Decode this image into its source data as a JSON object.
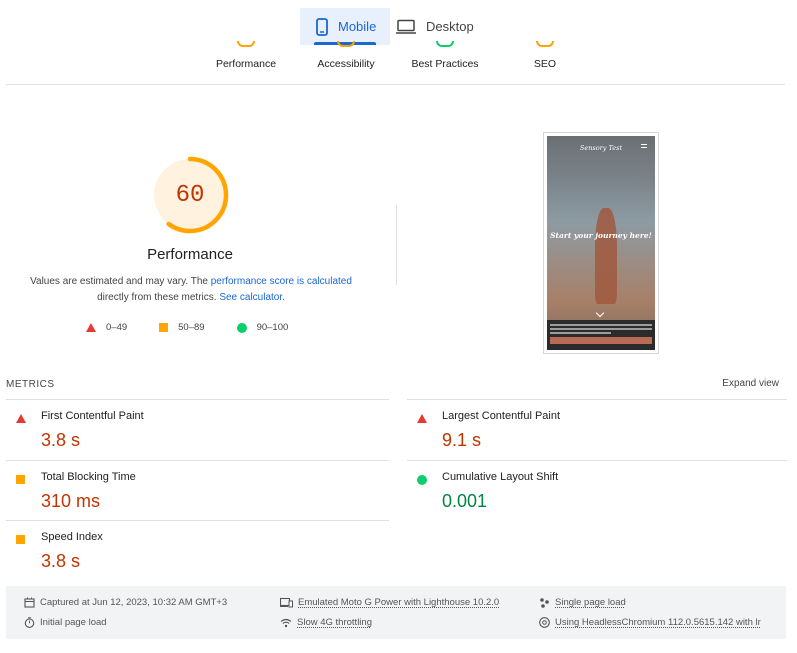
{
  "tabs": [
    {
      "label": "Mobile",
      "icon": "phone-icon",
      "active": true
    },
    {
      "label": "Desktop",
      "icon": "monitor-icon",
      "active": false
    }
  ],
  "categories": [
    "Performance",
    "Accessibility",
    "Best Practices",
    "SEO"
  ],
  "score": {
    "value": "60",
    "fraction": 0.6,
    "title": "Performance",
    "color": "#ffa400"
  },
  "note": {
    "pre": "Values are estimated and may vary. The ",
    "link1": "performance score is calculated",
    "mid": "directly from these metrics. ",
    "link2": "See calculator."
  },
  "legend": [
    {
      "label": "0–49",
      "shape": "triangle",
      "color": "#e53935"
    },
    {
      "label": "50–89",
      "shape": "square",
      "color": "#ffa400"
    },
    {
      "label": "90–100",
      "shape": "circle",
      "color": "#0cce6b"
    }
  ],
  "screenshot": {
    "brand": "Sensory Test",
    "headline": "Start your journey here!"
  },
  "metrics": {
    "heading": "METRICS",
    "expand_label": "Expand view",
    "items": [
      {
        "label": "First Contentful Paint",
        "value": "3.8 s",
        "status": "fail"
      },
      {
        "label": "Largest Contentful Paint",
        "value": "9.1 s",
        "status": "fail"
      },
      {
        "label": "Total Blocking Time",
        "value": "310 ms",
        "status": "average"
      },
      {
        "label": "Cumulative Layout Shift",
        "value": "0.001",
        "status": "pass"
      },
      {
        "label": "Speed Index",
        "value": "3.8 s",
        "status": "average"
      }
    ]
  },
  "footer": {
    "captured": "Captured at Jun 12, 2023, 10:32 AM GMT+3",
    "initial_load": "Initial page load",
    "device": "Emulated Moto G Power with Lighthouse 10.2.0",
    "throttling": "Slow 4G throttling",
    "single_load": "Single page load",
    "browser": "Using HeadlessChromium 112.0.5615.142 with lr"
  },
  "colors": {
    "fail": "#e53935",
    "average": "#ffa400",
    "pass": "#0cce6b",
    "accent": "#1967d2"
  }
}
